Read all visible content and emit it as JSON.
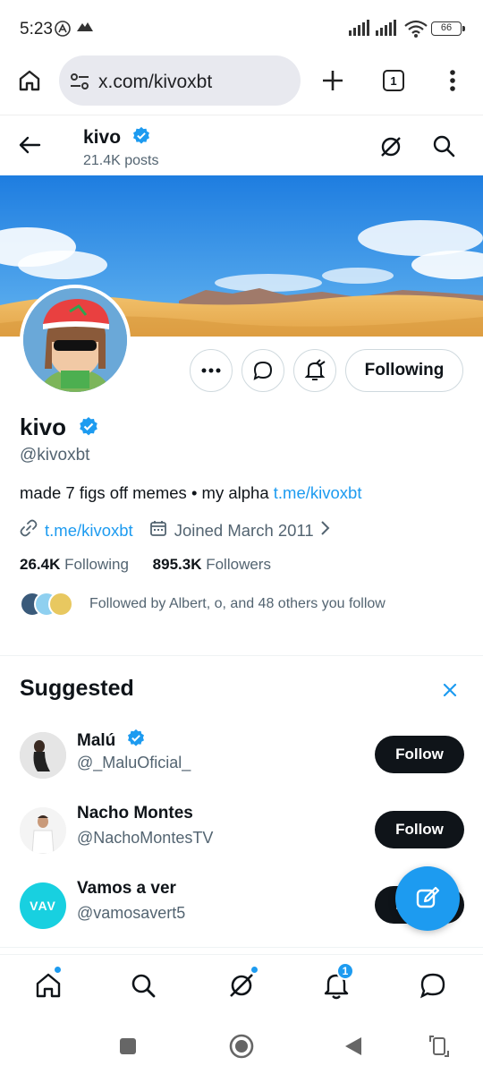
{
  "status_bar": {
    "time": "5:23",
    "battery": "66"
  },
  "browser": {
    "url": "x.com/kivoxbt",
    "tab_count": "1"
  },
  "profile": {
    "name": "kivo",
    "posts": "21.4K posts",
    "handle": "@kivoxbt",
    "bio_text": "made 7 figs off memes • my alpha ",
    "bio_link": "t.me/kivoxbt",
    "website": "t.me/kivoxbt",
    "joined": "Joined March 2011",
    "following_count": "26.4K",
    "following_label": "Following",
    "followers_count": "895.3K",
    "followers_label": "Followers",
    "followed_by": "Followed by Albert, o, and 48 others you follow",
    "following_button": "Following"
  },
  "suggested": {
    "title": "Suggested",
    "items": [
      {
        "name": "Malú",
        "handle": "@_MaluOficial_",
        "verified": true,
        "button": "Follow"
      },
      {
        "name": "Nacho Montes",
        "handle": "@NachoMontesTV",
        "verified": false,
        "button": "Follow"
      },
      {
        "name": "Vamos a ver",
        "handle": "@vamosavert5",
        "verified": false,
        "button": "Follow",
        "avatar_text": "VAV"
      }
    ]
  },
  "bottom_nav": {
    "items": [
      "home-icon",
      "search-icon",
      "grok-icon",
      "notifications-icon",
      "messages-icon"
    ],
    "notification_badge": "1"
  },
  "colors": {
    "accent": "#1d9bf0",
    "text": "#0f1419",
    "secondary": "#536471"
  }
}
